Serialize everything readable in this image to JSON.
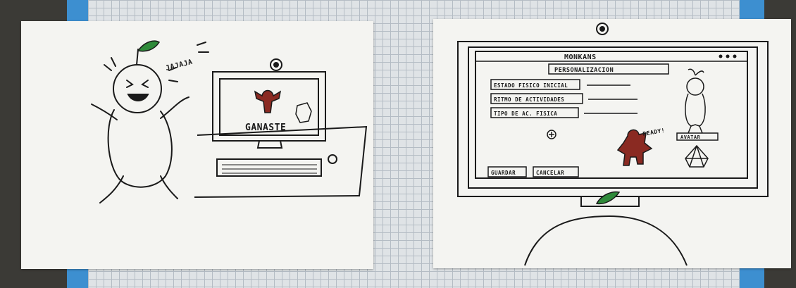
{
  "left_sheet": {
    "laugh_text": "JAJAJA",
    "screen_text": "GANASTE"
  },
  "right_sheet": {
    "app_title": "MONKANS",
    "tab_label": "PERSONALIZACION",
    "fields": [
      {
        "label": "ESTADO FISICO INICIAL"
      },
      {
        "label": "RITMO DE ACTIVIDADES"
      },
      {
        "label": "TIPO DE AC. FISICA"
      }
    ],
    "mascot_text": "READY!",
    "avatar_label": "AVATAR",
    "buttons": {
      "save": "GUARDAR",
      "cancel": "CANCELAR"
    }
  },
  "colors": {
    "ink": "#1a1a1a",
    "leaf": "#2f8a3a",
    "mascot": "#8a2a22"
  }
}
